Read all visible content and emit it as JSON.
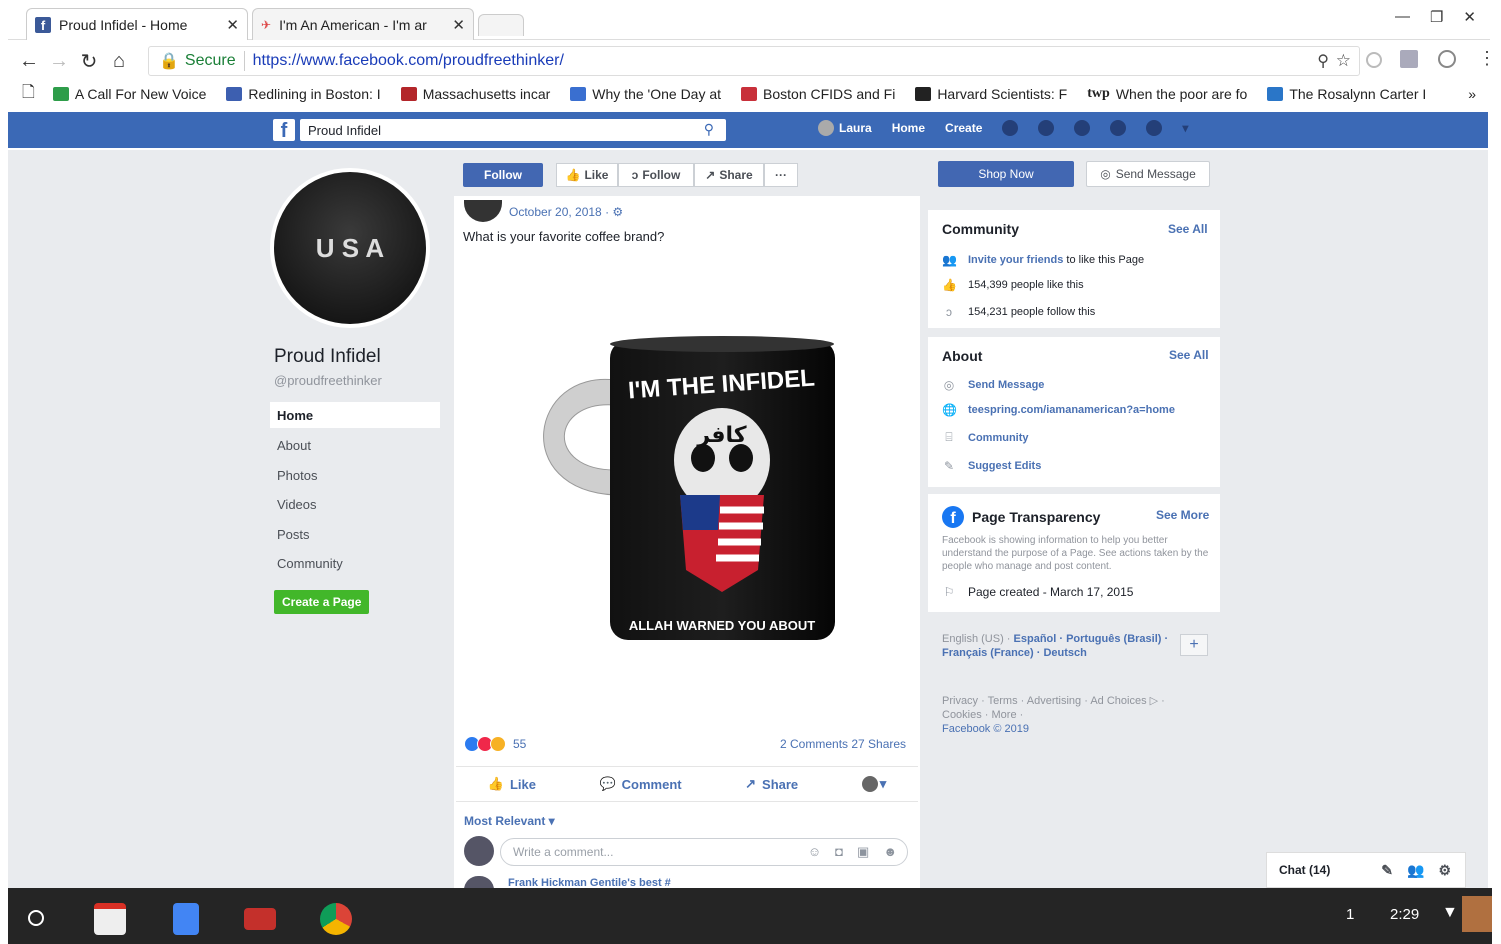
{
  "browser": {
    "tabs": [
      {
        "title": "Proud Infidel - Home",
        "active": true
      },
      {
        "title": "I'm An American - I'm ar",
        "active": false
      }
    ],
    "url_secure_label": "Secure",
    "url": "https://www.facebook.com/proudfreethinker/",
    "bookmarks": [
      {
        "label": "A Call For New Voice",
        "icon": "green-m-icon",
        "color": "#2e9d4a"
      },
      {
        "label": "Redlining in Boston: I",
        "icon": "list-icon",
        "color": "#3d5fb0"
      },
      {
        "label": "Massachusetts incar",
        "icon": "red-a-icon",
        "color": "#b3262a"
      },
      {
        "label": "Why the 'One Day at",
        "icon": "blue-square-icon",
        "color": "#3a6fd0"
      },
      {
        "label": "Boston CFIDS and Fi",
        "icon": "red-flag-icon",
        "color": "#c8303a"
      },
      {
        "label": "Harvard Scientists: F",
        "icon": "u-icon",
        "color": "#222222"
      },
      {
        "label": "When the poor are fo",
        "icon": "twp-icon",
        "color": "#222222"
      },
      {
        "label": "The Rosalynn Carter I",
        "icon": "blue-swirl-icon",
        "color": "#2a76c8"
      }
    ]
  },
  "fb": {
    "search_value": "Proud Infidel",
    "nav": {
      "user": "Laura",
      "home": "Home",
      "create": "Create"
    },
    "page": {
      "name": "Proud Infidel",
      "handle": "@proudfreethinker",
      "avatar_text": "U S A",
      "nav": [
        "Home",
        "About",
        "Photos",
        "Videos",
        "Posts",
        "Community"
      ],
      "create_page": "Create a Page"
    },
    "actions": {
      "follow_primary": "Follow",
      "like": "Like",
      "follow": "Follow",
      "share": "Share",
      "more": "···"
    },
    "post": {
      "date": "October 20, 2018 · ⚙",
      "text": "What is your favorite coffee brand?",
      "mug_top": "I'M THE INFIDEL",
      "mug_arabic": "كافر",
      "mug_bottom": "ALLAH WARNED YOU ABOUT",
      "reactions_count": "55",
      "comments_shares": "2 Comments  27 Shares",
      "btn_like": "Like",
      "btn_comment": "Comment",
      "btn_share": "Share",
      "most_relevant": "Most Relevant ▾",
      "comment_placeholder": "Write a comment...",
      "next_comment_name": "Frank Hickman Gentile's best #"
    },
    "right": {
      "shop_now": "Shop Now",
      "send_message": "Send Message",
      "community_title": "Community",
      "see_all": "See All",
      "invite_link": "Invite your friends",
      "invite_rest": "to like this Page",
      "likes": "154,399 people like this",
      "follows": "154,231 people follow this",
      "about_title": "About",
      "about_send": "Send Message",
      "about_link": "teespring.com/iamanamerican?a=home",
      "about_community": "Community",
      "about_suggest": "Suggest Edits",
      "transparency_title": "Page Transparency",
      "see_more": "See More",
      "transparency_text": "Facebook is showing information to help you better understand the purpose of a Page. See actions taken by the people who manage and post content.",
      "page_created": "Page created - March 17, 2015",
      "lang_current": "English (US) · ",
      "lang_others": "Español · Português (Brasil) · Français (France) · Deutsch",
      "footer": "Privacy · Terms · Advertising · Ad Choices ▷ · Cookies · More ·",
      "copyright": "Facebook © 2019"
    },
    "chat": "Chat (14)"
  },
  "shelf": {
    "notification": "1",
    "time": "2:29"
  }
}
